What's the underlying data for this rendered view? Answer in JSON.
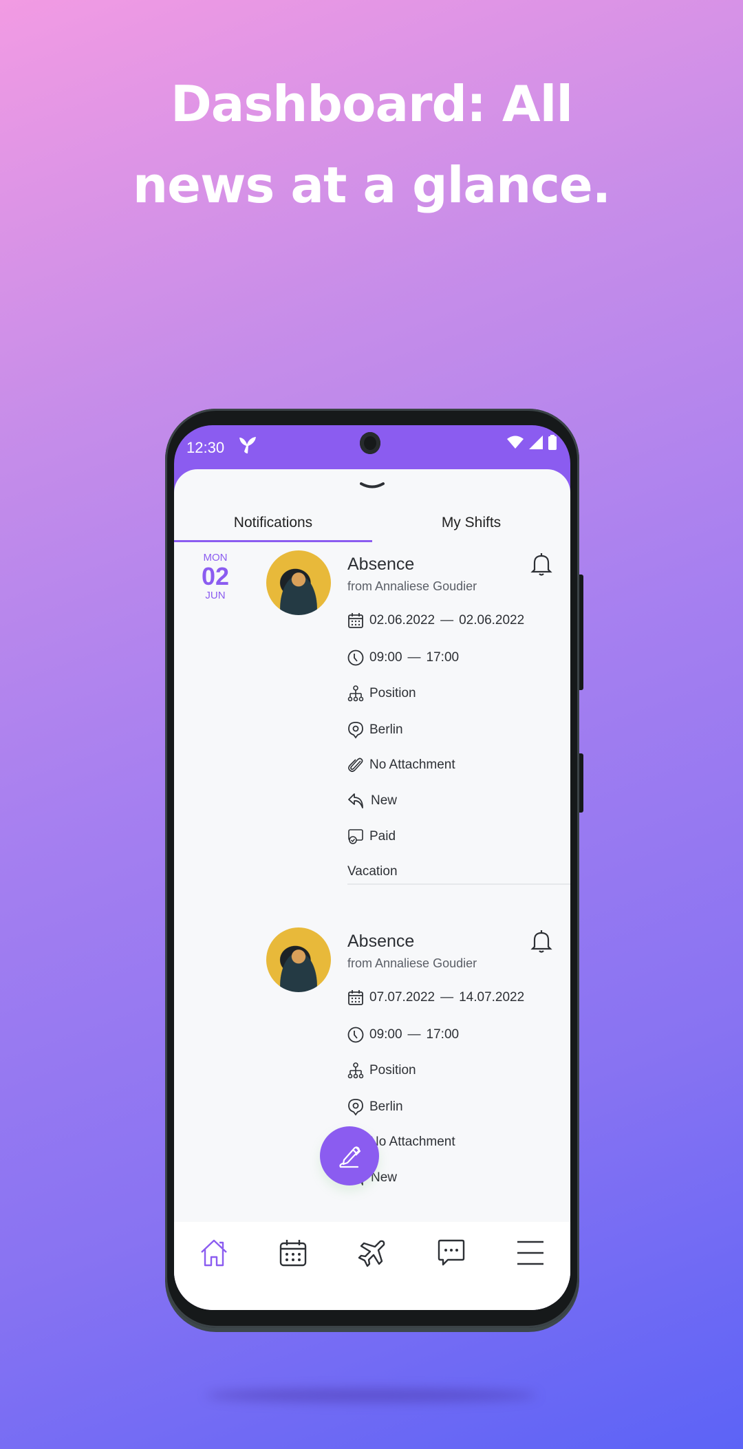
{
  "headline": {
    "line1": "Dashboard: All",
    "line2": "news at a glance."
  },
  "status_bar": {
    "time": "12:30",
    "app_logo": "Y",
    "icons": [
      "wifi-icon",
      "signal-icon",
      "battery-icon"
    ]
  },
  "tabs": [
    {
      "label": "Notifications",
      "active": true
    },
    {
      "label": "My Shifts",
      "active": false
    }
  ],
  "date_header": {
    "day_of_week": "MON",
    "day": "02",
    "month": "JUN"
  },
  "notifications": [
    {
      "title": "Absence",
      "subtitle": "from Annaliese Goudier",
      "date_range": {
        "start": "02.06.2022",
        "separator": "—",
        "end": "02.06.2022"
      },
      "time_range": {
        "start": "09:00",
        "separator": "—",
        "end": "17:00"
      },
      "position": "Position",
      "location": "Berlin",
      "attachment": "No Attachment",
      "status": "New",
      "payment": "Paid",
      "type": "Vacation"
    },
    {
      "title": "Absence",
      "subtitle": "from Annaliese Goudier",
      "date_range": {
        "start": "07.07.2022",
        "separator": "—",
        "end": "14.07.2022"
      },
      "time_range": {
        "start": "09:00",
        "separator": "—",
        "end": "17:00"
      },
      "position": "Position",
      "location": "Berlin",
      "attachment": "No Attachment",
      "status": "New"
    }
  ],
  "bottom_nav": [
    {
      "icon": "home-icon",
      "active": true
    },
    {
      "icon": "calendar-icon",
      "active": false
    },
    {
      "icon": "airplane-icon",
      "active": false
    },
    {
      "icon": "chat-icon",
      "active": false
    },
    {
      "icon": "menu-icon",
      "active": false
    }
  ],
  "fab": {
    "icon": "pen-icon"
  },
  "colors": {
    "accent": "#8b5cf0",
    "text": "#2d3035",
    "subtext": "#5a5e66",
    "sheet_bg": "#f7f8fa"
  }
}
